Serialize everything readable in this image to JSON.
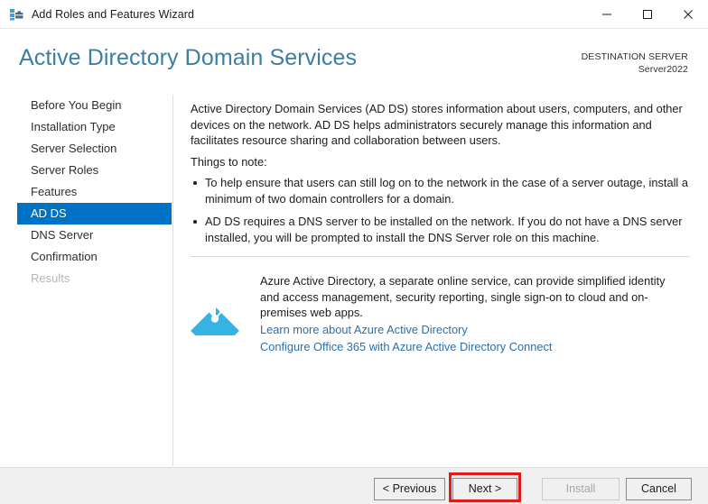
{
  "window": {
    "title": "Add Roles and Features Wizard",
    "icon": "server-roles-icon",
    "controls": {
      "minimize": "minimize-icon",
      "maximize": "maximize-icon",
      "close": "close-icon"
    }
  },
  "header": {
    "title": "Active Directory Domain Services",
    "destination_server_label": "DESTINATION SERVER",
    "destination_server_name": "Server2022",
    "accent_color": "#3c7ea4"
  },
  "sidebar": {
    "items": [
      {
        "label": "Before You Begin",
        "state": "normal"
      },
      {
        "label": "Installation Type",
        "state": "normal"
      },
      {
        "label": "Server Selection",
        "state": "normal"
      },
      {
        "label": "Server Roles",
        "state": "normal"
      },
      {
        "label": "Features",
        "state": "normal"
      },
      {
        "label": "AD DS",
        "state": "selected"
      },
      {
        "label": "DNS Server",
        "state": "normal"
      },
      {
        "label": "Confirmation",
        "state": "normal"
      },
      {
        "label": "Results",
        "state": "disabled"
      }
    ],
    "selected_color": "#0072c6"
  },
  "main": {
    "intro": "Active Directory Domain Services (AD DS) stores information about users, computers, and other devices on the network.  AD DS helps administrators securely manage this information and facilitates resource sharing and collaboration between users.",
    "things_to_note_label": "Things to note:",
    "notes": [
      "To help ensure that users can still log on to the network in the case of a server outage, install a minimum of two domain controllers for a domain.",
      "AD DS requires a DNS server to be installed on the network.  If you do not have a DNS server installed, you will be prompted to install the DNS Server role on this machine."
    ],
    "azure": {
      "icon": "azure-active-directory-icon",
      "icon_color": "#35b3e3",
      "description": "Azure Active Directory, a separate online service, can provide simplified identity and access management, security reporting, single sign-on to cloud and on-premises web apps.",
      "links": [
        "Learn more about Azure Active Directory",
        "Configure Office 365 with Azure Active Directory Connect"
      ],
      "link_color": "#2c6fa8"
    }
  },
  "footer": {
    "buttons": [
      {
        "label": "< Previous",
        "state": "enabled"
      },
      {
        "label": "Next >",
        "state": "enabled"
      },
      {
        "label": "Install",
        "state": "disabled"
      },
      {
        "label": "Cancel",
        "state": "enabled"
      }
    ]
  },
  "annotation": {
    "highlight_target": "Next >",
    "highlight_color": "#e01b1b"
  }
}
